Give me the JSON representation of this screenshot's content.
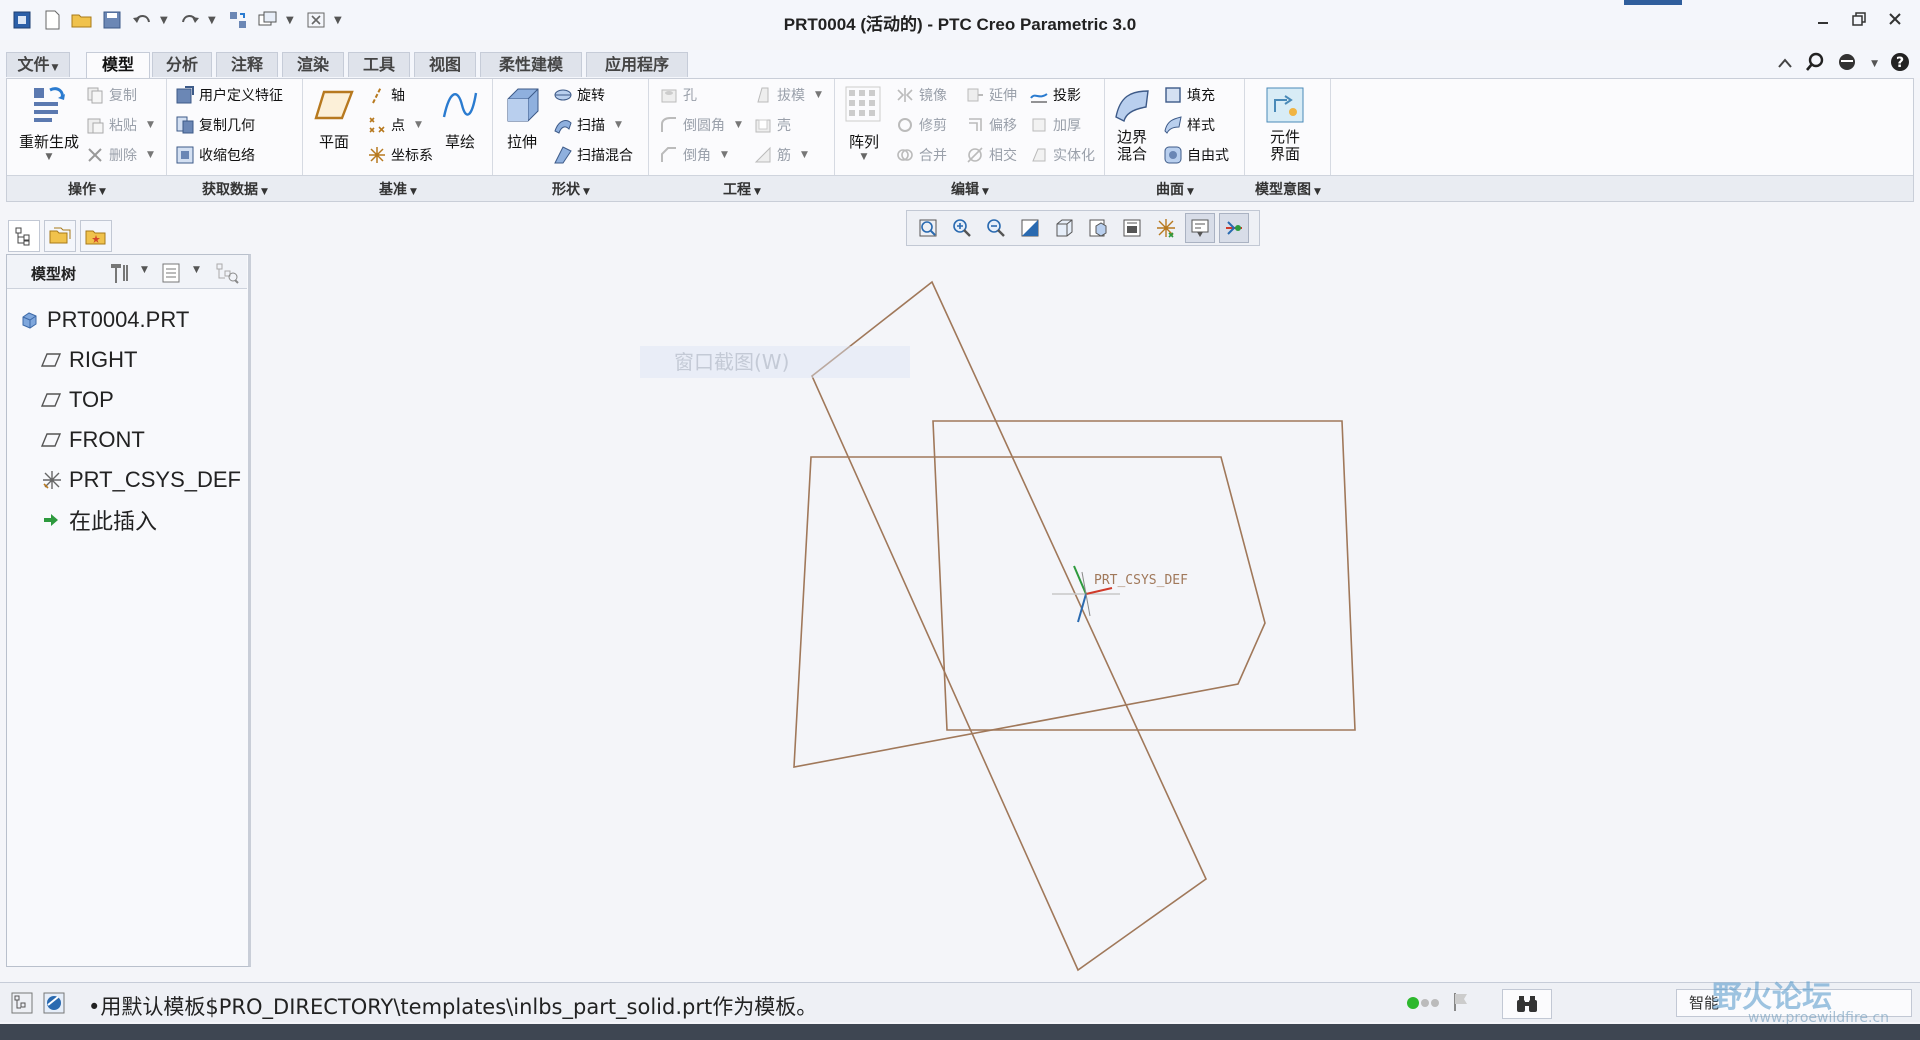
{
  "window": {
    "title": "PRT0004 (活动的) - PTC Creo Parametric 3.0"
  },
  "tabs": [
    {
      "label": "文件",
      "has_caret": true
    },
    {
      "label": "模型"
    },
    {
      "label": "分析"
    },
    {
      "label": "注释"
    },
    {
      "label": "渲染"
    },
    {
      "label": "工具"
    },
    {
      "label": "视图"
    },
    {
      "label": "柔性建模"
    },
    {
      "label": "应用程序"
    }
  ],
  "active_tab": "模型",
  "ribbon": {
    "groups": [
      {
        "label": "操作"
      },
      {
        "label": "获取数据"
      },
      {
        "label": "基准"
      },
      {
        "label": "形状"
      },
      {
        "label": "工程"
      },
      {
        "label": "编辑"
      },
      {
        "label": "曲面"
      },
      {
        "label": "模型意图"
      }
    ],
    "operations": {
      "regenerate": "重新生成",
      "copy": "复制",
      "paste": "粘贴",
      "delete": "删除"
    },
    "get_data": {
      "udf": "用户定义特征",
      "copy_geom": "复制几何",
      "shrinkwrap": "收缩包络"
    },
    "datum": {
      "plane": "平面",
      "axis": "轴",
      "point": "点",
      "csys": "坐标系",
      "sketch": "草绘"
    },
    "shapes": {
      "extrude": "拉伸",
      "revolve": "旋转",
      "sweep": "扫描",
      "swept_blend": "扫描混合"
    },
    "engineering": {
      "hole": "孔",
      "round": "倒圆角",
      "chamfer": "倒角",
      "draft": "拔模",
      "shell": "壳",
      "rib": "筋"
    },
    "editing": {
      "pattern": "阵列",
      "mirror": "镜像",
      "trim": "修剪",
      "merge": "合并",
      "extend": "延伸",
      "offset": "偏移",
      "intersect": "相交",
      "project": "投影",
      "thicken": "加厚",
      "solidify": "实体化"
    },
    "surfaces": {
      "boundary_blend": "边界混合",
      "fill": "填充",
      "style": "样式",
      "freestyle": "自由式"
    },
    "model_intent": {
      "component_interface": "元件界面"
    }
  },
  "model_tree": {
    "title": "模型树",
    "items": [
      {
        "label": "PRT0004.PRT",
        "icon": "part-icon"
      },
      {
        "label": "RIGHT",
        "icon": "datum-plane-icon"
      },
      {
        "label": "TOP",
        "icon": "datum-plane-icon"
      },
      {
        "label": "FRONT",
        "icon": "datum-plane-icon"
      },
      {
        "label": "PRT_CSYS_DEF",
        "icon": "csys-icon"
      },
      {
        "label": "在此插入",
        "icon": "insert-here-icon"
      }
    ]
  },
  "canvas": {
    "csys_label": "PRT_CSYS_DEF",
    "ghost_menu": "窗口截图(W)",
    "line_color": "#a0785a"
  },
  "status": {
    "message": "•用默认模板$PRO_DIRECTORY\\templates\\inlbs_part_solid.prt作为模板。",
    "filter": "智能"
  },
  "watermark": {
    "text": "野火论坛",
    "url": "www.proewildfire.cn"
  }
}
